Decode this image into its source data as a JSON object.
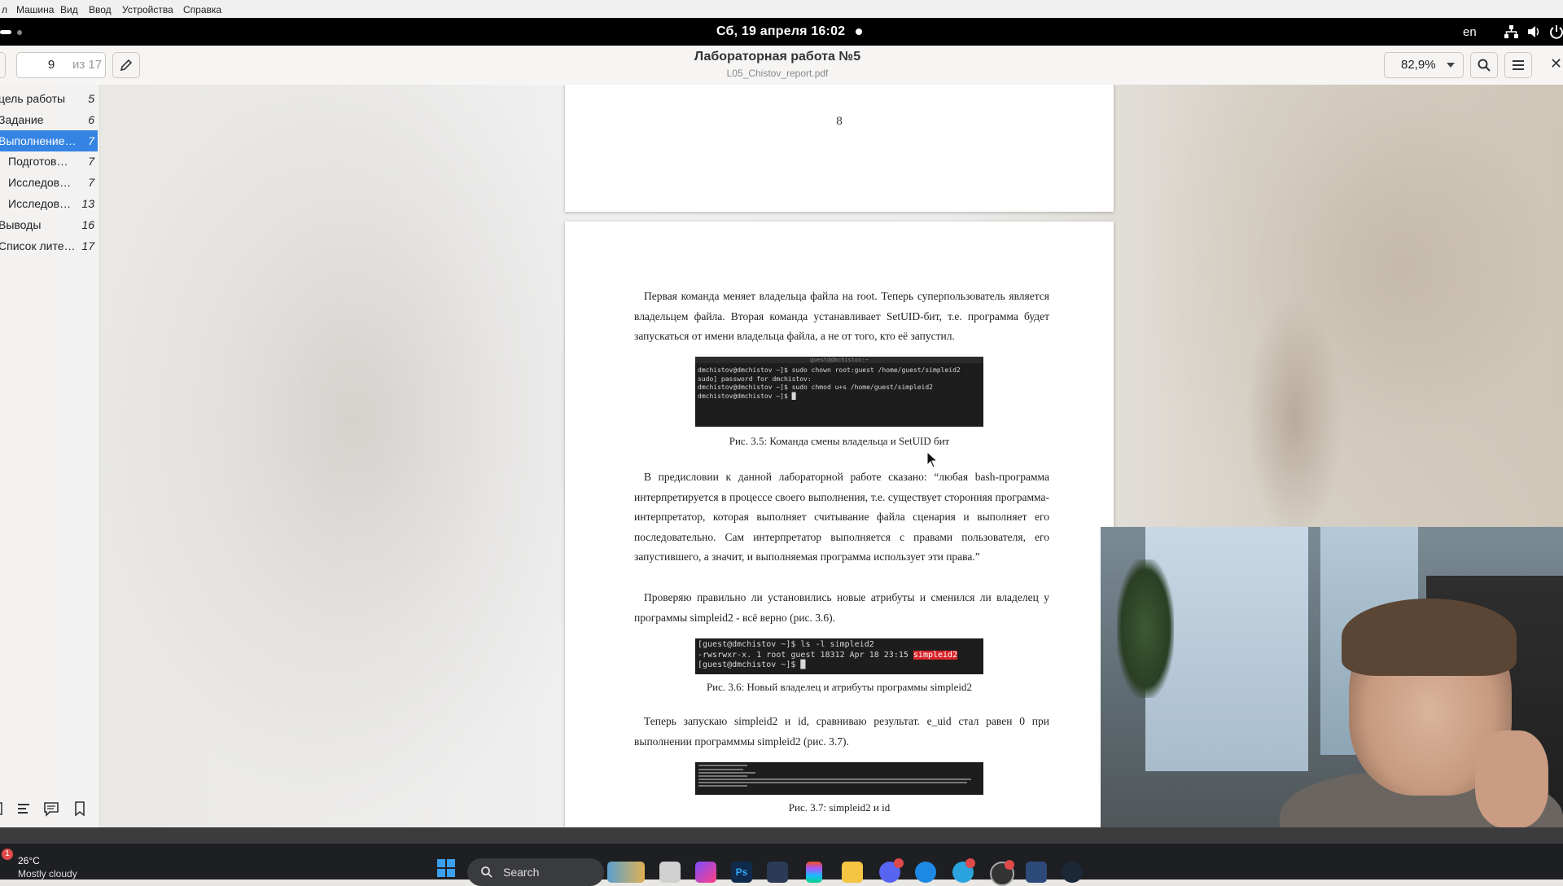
{
  "vm_menu": [
    "л",
    "Машина",
    "Вид",
    "Ввод",
    "Устройства",
    "Справка"
  ],
  "topbar": {
    "datetime": "Сб, 19 апреля  16:02",
    "lang": "en"
  },
  "header": {
    "page_current": "9",
    "page_of": "из 17",
    "title": "Лабораторная работа №5",
    "filename": "L05_Chistov_report.pdf",
    "zoom": "82,9%"
  },
  "toc": [
    {
      "label": "цель работы",
      "page": "5",
      "indent": 0,
      "selected": false
    },
    {
      "label": "Задание",
      "page": "6",
      "indent": 0,
      "selected": false
    },
    {
      "label": "Выполнение…",
      "page": "7",
      "indent": 0,
      "selected": true
    },
    {
      "label": "Подготов…",
      "page": "7",
      "indent": 1,
      "selected": false
    },
    {
      "label": "Исследов…",
      "page": "7",
      "indent": 1,
      "selected": false
    },
    {
      "label": "Исследов…",
      "page": "13",
      "indent": 1,
      "selected": false
    },
    {
      "label": "Выводы",
      "page": "16",
      "indent": 0,
      "selected": false
    },
    {
      "label": "Список лите…",
      "page": "17",
      "indent": 0,
      "selected": false
    }
  ],
  "document": {
    "prev_page_number": "8",
    "para1": "Первая команда меняет владельца файла на root. Теперь суперпользователь является владельцем файла. Вторая команда устанавливает SetUID-бит, т.е. программа будет запускаться от имени владельца файла, а не от того, кто её запустил.",
    "term1": {
      "title": "guest@dmchistov:~",
      "lines": [
        "dmchistov@dmchistov ~]$ sudo chown root:guest /home/guest/simpleid2",
        "sudo] password for dmchistov:",
        "dmchistov@dmchistov ~]$ sudo chmod u+s /home/guest/simpleid2",
        "dmchistov@dmchistov ~]$ █"
      ]
    },
    "caption1": "Рис. 3.5: Команда смены владельца и SetUID бит",
    "para2": "В предисловии к данной лабораторной работе сказано: “любая bash-программа интерпретируется в процессе своего выполнения, т.е. существует сторонняя программа-интерпретатор, которая выполняет считывание файла сценария и выполняет его последовательно. Сам интерпретатор выполняется с правами пользователя, его запустившего, а значит, и выполняемая программа использует эти права.”",
    "para3": "Проверяю правильно ли установились новые атрибуты и сменился ли владелец у программы simpleid2 - всё верно (рис. 3.6).",
    "term2": {
      "line1": "[guest@dmchistov ~]$ ls -l simpleid2",
      "line2_prefix": "-rwsrwxr-x. 1 root guest 18312 Apr 18 23:15 ",
      "line2_highlight": "simpleid2",
      "line3": "[guest@dmchistov ~]$ █"
    },
    "caption2": "Рис. 3.6: Новый владелец и атрибуты программы simpleid2",
    "para4": "Теперь запускаю simpleid2 и id, сравниваю результат. e_uid стал равен 0 при выполнении программмы simpleid2 (рис. 3.7).",
    "caption3": "Рис. 3.7: simpleid2 и id"
  },
  "taskbar": {
    "weather_badge": "1",
    "temp": "26°C",
    "weather": "Mostly cloudy",
    "search": "Search"
  }
}
